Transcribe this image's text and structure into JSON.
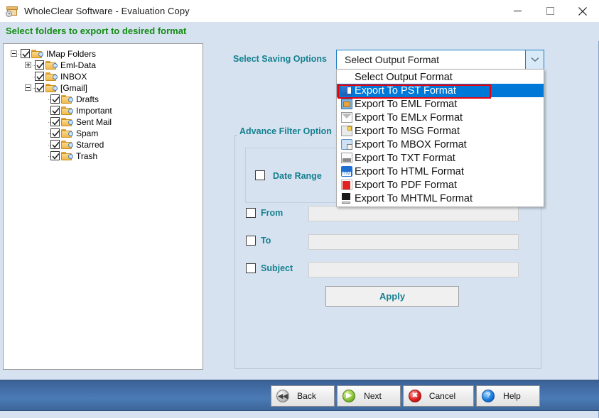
{
  "window": {
    "title": "WholeClear Software - Evaluation Copy",
    "app_icon": "archive-box-icon",
    "minimize_label": "—",
    "maximize_label": "□",
    "close_label": "✕"
  },
  "header": {
    "instruction": "Select folders to export to desired format",
    "instruction_color": "#128c12"
  },
  "tree": {
    "nodes": [
      {
        "label": "IMap Folders",
        "depth": 0,
        "checked": true,
        "expander": "minus"
      },
      {
        "label": "Eml-Data",
        "depth": 1,
        "checked": true,
        "expander": "plus"
      },
      {
        "label": "INBOX",
        "depth": 1,
        "checked": true,
        "expander": "none"
      },
      {
        "label": "[Gmail]",
        "depth": 1,
        "checked": true,
        "expander": "minus"
      },
      {
        "label": "Drafts",
        "depth": 2,
        "checked": true,
        "expander": "none"
      },
      {
        "label": "Important",
        "depth": 2,
        "checked": true,
        "expander": "none"
      },
      {
        "label": "Sent Mail",
        "depth": 2,
        "checked": true,
        "expander": "none"
      },
      {
        "label": "Spam",
        "depth": 2,
        "checked": true,
        "expander": "none"
      },
      {
        "label": "Starred",
        "depth": 2,
        "checked": true,
        "expander": "none"
      },
      {
        "label": "Trash",
        "depth": 2,
        "checked": true,
        "expander": "none"
      }
    ]
  },
  "saving_options": {
    "label": "Select Saving Options",
    "label_color": "#15808f",
    "combo_value": "Select Output Format",
    "dropdown_open": true,
    "highlight_color": "#e8000d",
    "selection_color": "#0078d7",
    "options": [
      {
        "label": "Select Output Format",
        "icon": "none"
      },
      {
        "label": "Export To PST Format",
        "icon": "pst-icon"
      },
      {
        "label": "Export To EML Format",
        "icon": "eml-icon"
      },
      {
        "label": "Export To EMLx Format",
        "icon": "emlx-icon"
      },
      {
        "label": "Export To MSG Format",
        "icon": "msg-icon"
      },
      {
        "label": "Export To MBOX Format",
        "icon": "mbox-icon"
      },
      {
        "label": "Export To TXT Format",
        "icon": "txt-icon"
      },
      {
        "label": "Export To HTML Format",
        "icon": "html-icon"
      },
      {
        "label": "Export To PDF Format",
        "icon": "pdf-icon"
      },
      {
        "label": "Export To MHTML Format",
        "icon": "mhtml-icon"
      }
    ],
    "selected_index": 1
  },
  "filter": {
    "legend": "Advance Filter Option",
    "date_range_label": "Date Range",
    "date_range_checked": false,
    "rows": [
      {
        "label": "From",
        "value": "",
        "checked": false
      },
      {
        "label": "To",
        "value": "",
        "checked": false
      },
      {
        "label": "Subject",
        "value": "",
        "checked": false
      }
    ],
    "apply_label": "Apply"
  },
  "footer": {
    "buttons": [
      {
        "label": "Back",
        "icon": "back-icon",
        "glyph": "◀◀"
      },
      {
        "label": "Next",
        "icon": "next-icon",
        "glyph": "▶"
      },
      {
        "label": "Cancel",
        "icon": "cancel-icon",
        "glyph": "✖"
      },
      {
        "label": "Help",
        "icon": "help-icon",
        "glyph": "?"
      }
    ]
  }
}
